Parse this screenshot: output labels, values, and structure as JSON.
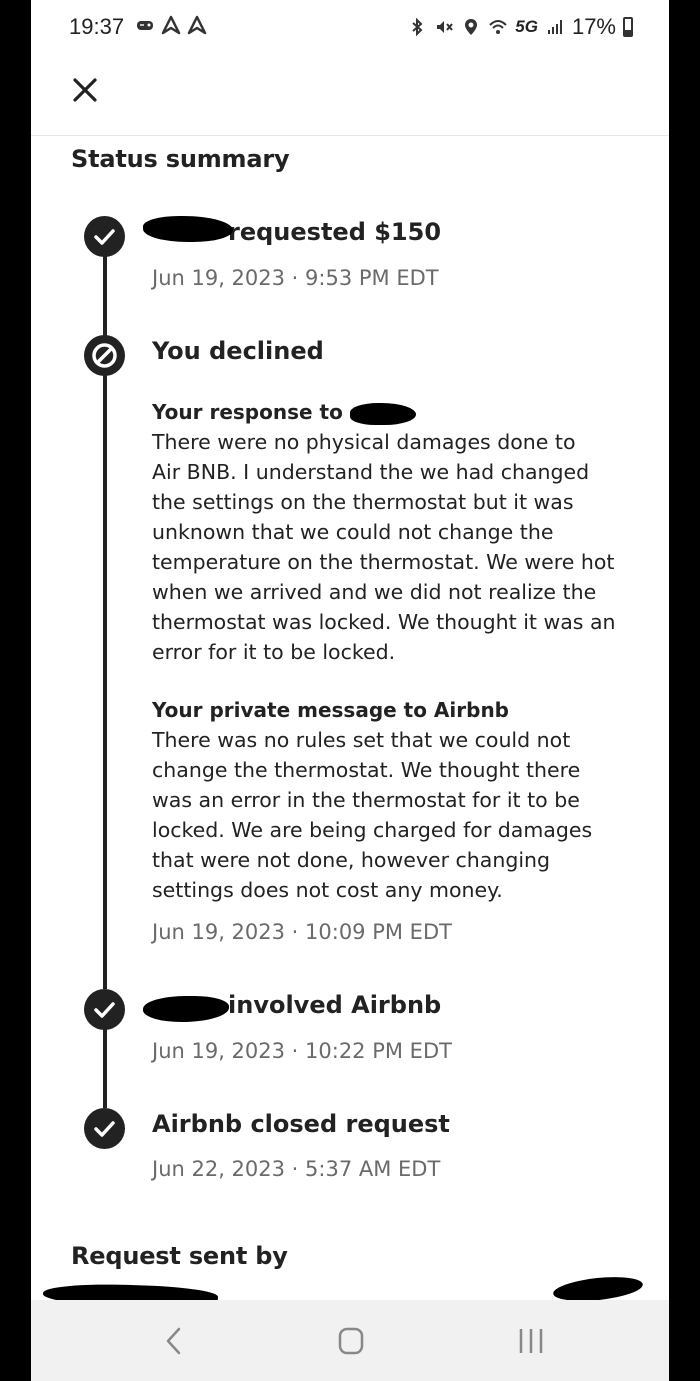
{
  "status_bar": {
    "time": "19:37",
    "network": "5G",
    "battery": "17%"
  },
  "page": {
    "title": "Status summary"
  },
  "timeline": [
    {
      "title_suffix": "requested $150",
      "date": "Jun 19, 2023 · 9:53 PM EDT",
      "icon": "check-circle-icon"
    },
    {
      "title": "You declined",
      "icon": "declined-circle-icon",
      "response_heading": "Your response to",
      "response_lines": [
        "There were no physical damages done to",
        "Air BNB. I understand the we had changed",
        "the settings on the thermostat but it was",
        "unknown that we could not change the",
        "temperature on the thermostat. We were hot",
        "when we arrived and we did not realize the",
        "thermostat was locked. We thought it was an",
        "error for it to be locked."
      ],
      "private_heading": "Your private message to Airbnb",
      "private_lines": [
        "There was no rules set that we could not",
        "change the thermostat. We thought there",
        "was an error in the thermostat for it to be",
        "locked. We are being charged for damages",
        "that were not done, however changing",
        "settings does not cost any money."
      ],
      "date": "Jun 19, 2023 · 10:09 PM EDT"
    },
    {
      "title_suffix": "involved Airbnb",
      "date": "Jun 19, 2023 · 10:22 PM EDT",
      "icon": "check-circle-icon"
    },
    {
      "title": "Airbnb closed request",
      "date": "Jun 22, 2023 · 5:37 AM EDT",
      "icon": "check-circle-icon"
    }
  ],
  "request_sent_by": {
    "title": "Request sent by"
  }
}
